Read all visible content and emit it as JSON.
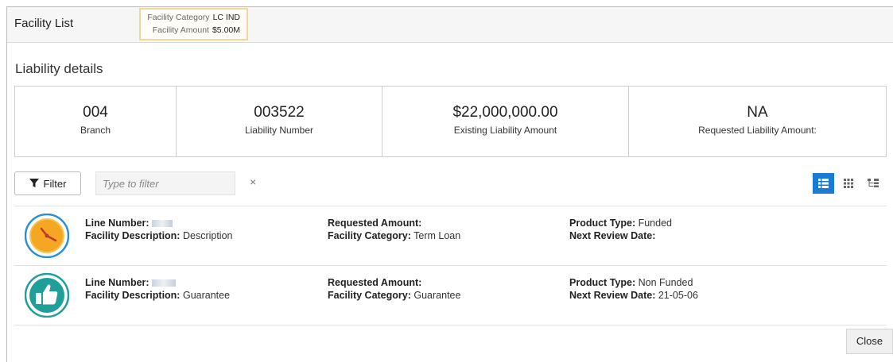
{
  "header": {
    "title": "Facility List"
  },
  "tooltip": {
    "category_label": "Facility Category",
    "category_value": "LC IND",
    "amount_label": "Facility Amount",
    "amount_value": "$5.00M"
  },
  "section_title": "Liability details",
  "summary": [
    {
      "value": "004",
      "label": "Branch"
    },
    {
      "value": "003522",
      "label": "Liability Number"
    },
    {
      "value": "$22,000,000.00",
      "label": "Existing Liability Amount"
    },
    {
      "value": "NA",
      "label": "Requested Liability Amount:"
    }
  ],
  "filter": {
    "button_label": "Filter",
    "placeholder": "Type to filter",
    "clear_symbol": "×"
  },
  "view_modes": [
    "list-view-icon",
    "grid-view-icon",
    "tree-view-icon"
  ],
  "list": [
    {
      "icon": "clock-icon",
      "line_number_label": "Line Number:",
      "facility_description_label": "Facility Description:",
      "facility_description": "Description",
      "requested_amount_label": "Requested Amount:",
      "requested_amount": "",
      "facility_category_label": "Facility Category:",
      "facility_category": "Term Loan",
      "product_type_label": "Product Type:",
      "product_type": "Funded",
      "next_review_label": "Next Review Date:",
      "next_review": ""
    },
    {
      "icon": "thumbs-up-icon",
      "line_number_label": "Line Number:",
      "facility_description_label": "Facility Description:",
      "facility_description": "Guarantee",
      "requested_amount_label": "Requested Amount:",
      "requested_amount": "",
      "facility_category_label": "Facility Category:",
      "facility_category": "Guarantee",
      "product_type_label": "Product Type:",
      "product_type": "Non Funded",
      "next_review_label": "Next Review Date:",
      "next_review": "21-05-06"
    }
  ],
  "close_label": "Close",
  "colors": {
    "accent": "#1a7bd4",
    "clock": "#f5a623",
    "thumb": "#1f9e9a",
    "tooltip_border": "#f2d79a"
  }
}
